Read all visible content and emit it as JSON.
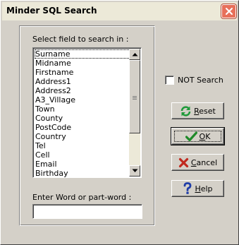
{
  "window": {
    "title": "Minder SQL Search"
  },
  "search_panel": {
    "field_prompt": "Select field to search in :",
    "fields": [
      "Surname",
      "Midname",
      "Firstname",
      "Address1",
      "Address2",
      "A3_Village",
      "Town",
      "County",
      "PostCode",
      "Country",
      "Tel",
      "Cell",
      "Email",
      "Birthday"
    ],
    "selected_field": "Surname",
    "word_prompt": "Enter Word or part-word :",
    "word_value": ""
  },
  "options": {
    "not_search_label": "NOT Search",
    "not_search_checked": false
  },
  "buttons": {
    "reset_mnemonic": "R",
    "reset_rest": "eset",
    "ok_mnemonic": "O",
    "ok_rest": "K",
    "cancel_mnemonic": "C",
    "cancel_rest": "ancel",
    "help_mnemonic": "H",
    "help_rest": "elp"
  },
  "icons": {
    "close": "close-icon",
    "reset": "refresh-icon",
    "ok": "check-icon",
    "cancel": "x-icon",
    "help": "question-icon"
  },
  "colors": {
    "dialog_bg": "#d4d0c8",
    "titlebar_bg": "#ece9d8",
    "close_button": "#e7705a",
    "reset_icon": "#1f9a3a",
    "ok_icon": "#1f8a2a",
    "cancel_icon": "#c0281e",
    "help_icon": "#1e3ca8"
  }
}
